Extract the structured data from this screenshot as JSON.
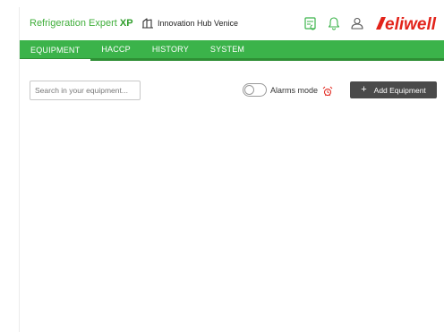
{
  "header": {
    "brand_prefix": "Refrigeration Expert",
    "brand_suffix": "XP",
    "site_name": "Innovation Hub Venice",
    "icons": [
      "sync-icon",
      "bell-icon",
      "user-icon"
    ],
    "logo_text": "eliwell"
  },
  "nav": {
    "tabs": [
      {
        "label": "EQUIPMENT",
        "active": true
      },
      {
        "label": "HACCP",
        "active": false
      },
      {
        "label": "HISTORY",
        "active": false
      },
      {
        "label": "SYSTEM",
        "active": false
      }
    ]
  },
  "toolbar": {
    "search_placeholder": "Search in your equipment...",
    "alarms_label": "Alarms mode",
    "alarms_mode_on": false,
    "add_button_label": "Add Equipment"
  },
  "colors": {
    "brand_green": "#3bb34a",
    "logo_red": "#e2231a",
    "button_dark": "#4a4a4a"
  }
}
